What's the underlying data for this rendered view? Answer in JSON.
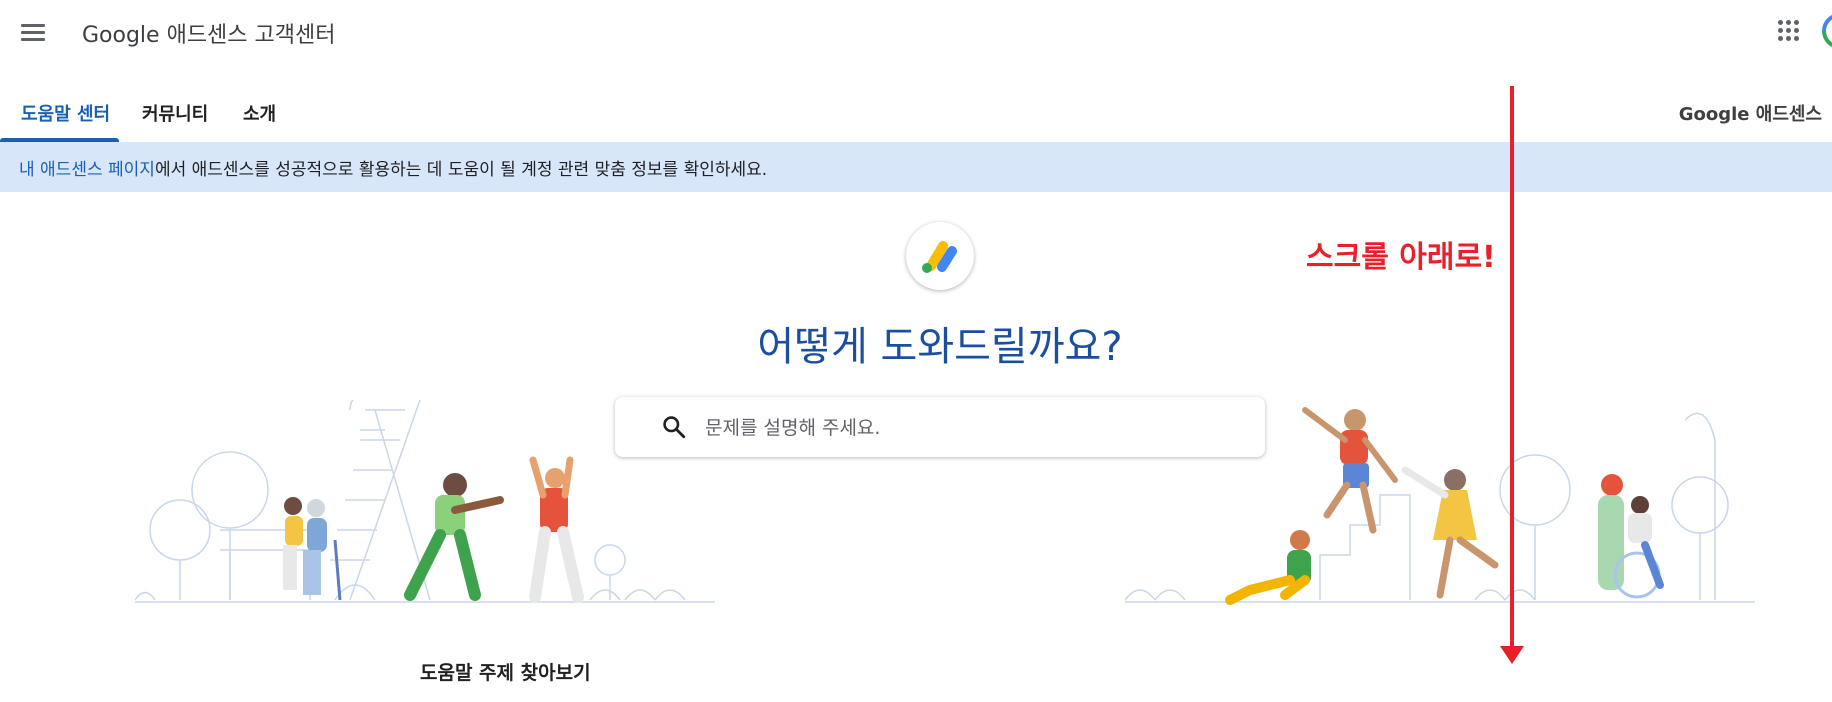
{
  "header": {
    "app_title": "Google 애드센스 고객센터",
    "menu_icon": "hamburger-menu-icon",
    "apps_icon": "google-apps-grid-icon",
    "account_icon": "account-avatar"
  },
  "tabs": [
    {
      "label": "도움말 센터",
      "active": true
    },
    {
      "label": "커뮤니티",
      "active": false
    },
    {
      "label": "소개",
      "active": false
    }
  ],
  "product_name": "Google 애드센스",
  "banner": {
    "link_text": "내 애드센스 페이지",
    "text": "에서 애드센스를 성공적으로 활용하는 데 도움이 될 계정 관련 맞춤 정보를 확인하세요."
  },
  "hero": {
    "logo_icon": "adsense-logo-icon",
    "title": "어떻게 도와드릴까요?",
    "search_placeholder": "문제를 설명해 주세요.",
    "search_value": ""
  },
  "section": {
    "heading": "도움말 주제 찾아보기"
  },
  "annotation": {
    "text": "스크롤 아래로!",
    "color": "#e8202a"
  },
  "colors": {
    "accent": "#1a5fb4",
    "banner_bg": "#d8e6fa",
    "title": "#1a4fa0"
  }
}
